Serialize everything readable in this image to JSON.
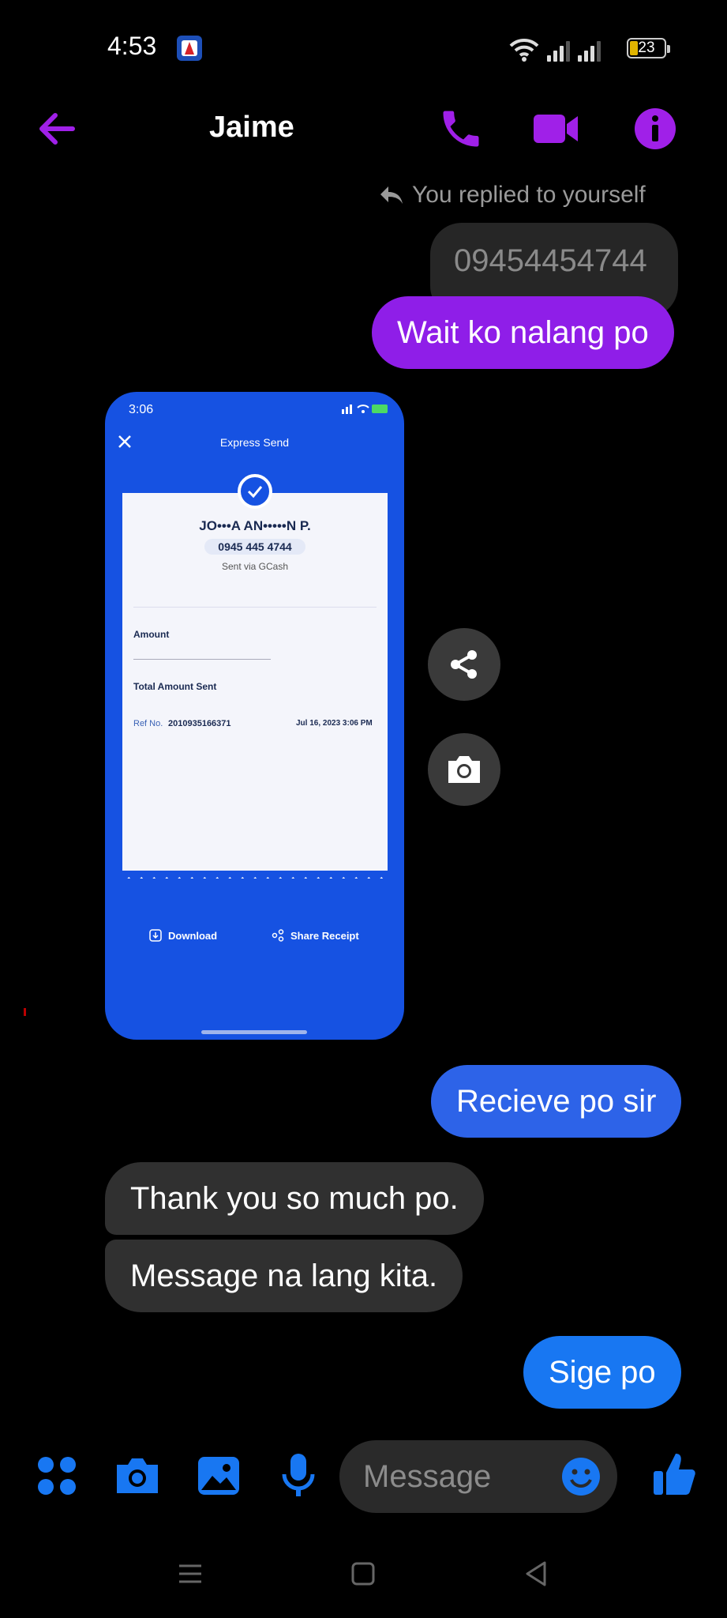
{
  "status_bar": {
    "time": "4:53",
    "battery": "23"
  },
  "header": {
    "contact_name": "Jaime",
    "accent_color": "#a020e8"
  },
  "messages": {
    "reply_note": "You replied to yourself",
    "quoted_text": "09454454744",
    "sent_1": "Wait ko nalang po",
    "sent_2": "Recieve po sir",
    "received_1": "Thank you so much po.",
    "received_2": "Message na lang kita.",
    "sent_3": "Sige po"
  },
  "receipt_image": {
    "time": "3:06",
    "title": "Express Send",
    "recipient_name": "JO•••A AN•••••N P.",
    "recipient_number": "0945 445 4744",
    "sent_via": "Sent via GCash",
    "amount_label": "Amount",
    "total_label": "Total Amount Sent",
    "ref_label": "Ref No.",
    "ref_number": "2010935166371",
    "date": "Jul 16, 2023 3:06 PM",
    "download_label": "Download",
    "share_label": "Share Receipt"
  },
  "composer": {
    "placeholder": "Message"
  },
  "colors": {
    "sent_blue": "#2d63e8",
    "sent_purple": "#8f1ee8",
    "received_gray": "#303030",
    "composer_icon_blue": "#1877f2"
  }
}
